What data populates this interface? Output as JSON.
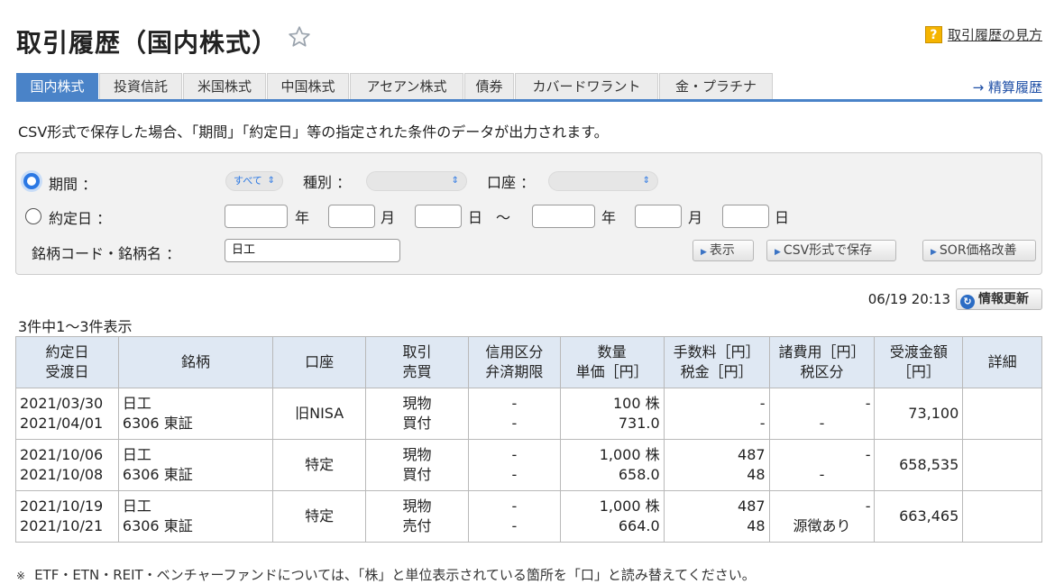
{
  "page": {
    "title": "取引履歴（国内株式）",
    "help_icon": "?",
    "help_link": "取引履歴の見方",
    "settlement_link": "→ 精算履歴"
  },
  "tabs": [
    "国内株式",
    "投資信託",
    "米国株式",
    "中国株式",
    "アセアン株式",
    "債券",
    "カバードワラント",
    "金・プラチナ"
  ],
  "csv_note": "CSV形式で保存した場合、「期間」「約定日」等の指定された条件のデータが出力されます。",
  "form": {
    "period_label": "期間 ：",
    "period_select": "すべて",
    "kind_label": "種別 ：",
    "kind_select": "",
    "account_label": "口座 ：",
    "account_select": "",
    "trade_date_label": "約定日 ：",
    "unit_year": "年",
    "unit_month": "月",
    "unit_day": "日",
    "tilde": "～",
    "code_label": "銘柄コード・銘柄名 ：",
    "code_value": "日工",
    "show_button": "表示",
    "csv_button": "CSV形式で保存",
    "sor_button": "SOR価格改善"
  },
  "timestamp": "06/19 20:13",
  "refresh_button": "情報更新",
  "count_text": "3件中1～3件表示",
  "table": {
    "headers": [
      [
        "約定日",
        "受渡日"
      ],
      [
        "銘柄"
      ],
      [
        "口座"
      ],
      [
        "取引",
        "売買"
      ],
      [
        "信用区分",
        "弁済期限"
      ],
      [
        "数量",
        "単価［円］"
      ],
      [
        "手数料［円］",
        "税金［円］"
      ],
      [
        "諸費用［円］",
        "税区分"
      ],
      [
        "受渡金額",
        "［円］"
      ],
      [
        "詳細"
      ]
    ],
    "rows": [
      {
        "trade_date": "2021/03/30",
        "settle_date": "2021/04/01",
        "name": "日工",
        "code": "6306 東証",
        "account": "旧NISA",
        "trade": "現物",
        "side": "買付",
        "margin": "-",
        "deadline": "-",
        "qty": "100 株",
        "price": "731.0",
        "fee": "-",
        "tax": "-",
        "cost": "-",
        "tax_type": "-",
        "amount": "73,100"
      },
      {
        "trade_date": "2021/10/06",
        "settle_date": "2021/10/08",
        "name": "日工",
        "code": "6306 東証",
        "account": "特定",
        "trade": "現物",
        "side": "買付",
        "margin": "-",
        "deadline": "-",
        "qty": "1,000 株",
        "price": "658.0",
        "fee": "487",
        "tax": "48",
        "cost": "-",
        "tax_type": "-",
        "amount": "658,535"
      },
      {
        "trade_date": "2021/10/19",
        "settle_date": "2021/10/21",
        "name": "日工",
        "code": "6306 東証",
        "account": "特定",
        "trade": "現物",
        "side": "売付",
        "margin": "-",
        "deadline": "-",
        "qty": "1,000 株",
        "price": "664.0",
        "fee": "487",
        "tax": "48",
        "cost": "-",
        "tax_type": "源徴あり",
        "amount": "663,465"
      }
    ]
  },
  "footnote_mark": "※",
  "footnote": "ETF・ETN・REIT・ベンチャーファンドについては、「株」と単位表示されている箇所を「口」と読み替えてください。",
  "colors": {
    "accent": "#4a83c8",
    "header_bg": "#dfe8f3",
    "help_icon": "#f5b400"
  }
}
